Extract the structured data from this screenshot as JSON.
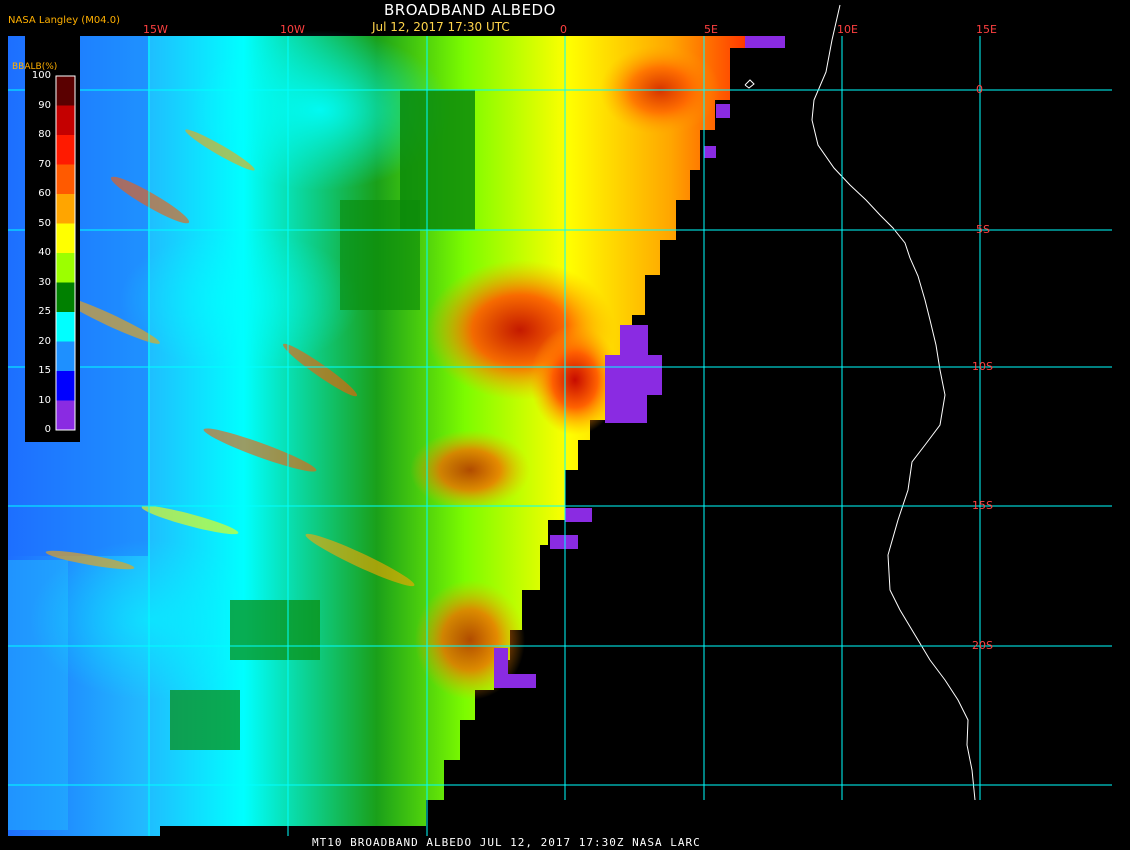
{
  "header": {
    "title": "BROADBAND ALBEDO",
    "timestamp": "Jul 12, 2017 17:30 UTC",
    "provider": "NASA Langley (M04.0)"
  },
  "footer": {
    "caption": "MT10  BROADBAND ALBEDO   JUL 12, 2017 17:30Z   NASA LARC"
  },
  "legend": {
    "title": "BBALB(%)",
    "ticks": [
      "100",
      "90",
      "80",
      "70",
      "60",
      "50",
      "40",
      "30",
      "25",
      "20",
      "15",
      "10",
      "0"
    ],
    "colors": [
      "#5a0000",
      "#c40000",
      "#ff1a00",
      "#ff5a00",
      "#ffa500",
      "#ffff00",
      "#9cff00",
      "#008000",
      "#00ffff",
      "#1e90ff",
      "#0000ff",
      "#8a2be2"
    ]
  },
  "grid": {
    "longitude_labels": [
      "15W",
      "10W",
      "0",
      "5E",
      "10E",
      "15E"
    ],
    "latitude_labels": [
      "0",
      "5S",
      "10S",
      "15S",
      "20S"
    ],
    "line_color": "#00ffff",
    "label_color": "#ff4040"
  },
  "colors": {
    "background": "#000000",
    "coastline": "#ffffff"
  }
}
